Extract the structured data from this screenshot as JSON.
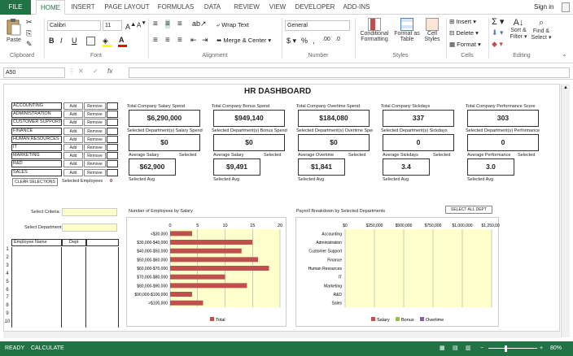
{
  "tabs": [
    "FILE",
    "HOME",
    "INSERT",
    "PAGE LAYOUT",
    "FORMULAS",
    "DATA",
    "REVIEW",
    "VIEW",
    "DEVELOPER",
    "ADD-INS"
  ],
  "account": "Sign in",
  "ribbon": {
    "clipboard": {
      "paste": "Paste",
      "label": "Clipboard"
    },
    "font": {
      "name": "Calibri",
      "size": "11",
      "label": "Font"
    },
    "alignment": {
      "wrap": "Wrap Text",
      "merge": "Merge & Center",
      "label": "Alignment"
    },
    "number": {
      "format": "General",
      "label": "Number"
    },
    "styles": {
      "cond1": "Conditional",
      "cond2": "Formatting",
      "fmt1": "Format as",
      "fmt2": "Table",
      "cell1": "Cell",
      "cell2": "Styles",
      "label": "Styles"
    },
    "cells": {
      "insert": "Insert",
      "delete": "Delete",
      "format": "Format",
      "label": "Cells"
    },
    "editing": {
      "sort1": "Sort &",
      "sort2": "Filter",
      "find1": "Find &",
      "find2": "Select",
      "label": "Editing"
    }
  },
  "formula_bar": {
    "name_box": "A50",
    "formula": ""
  },
  "dashboard": {
    "title": "HR DASHBOARD",
    "departments": [
      "ACCOUNTING",
      "ADMINISTRATION",
      "CUSTOMER SUPPORT",
      "FINANCE",
      "HUMAN RESOURCES",
      "IT",
      "MARKETING",
      "R&D",
      "SALES"
    ],
    "add_label": "Add",
    "remove_label": "Remove",
    "clear_selections": "CLEAR SELECTIONS",
    "selected_employees_label": "Selected Employees",
    "selected_employees_value": "0",
    "kpis": [
      {
        "title": "Total Company Salary Spend",
        "value": "$6,290,000",
        "sel_title": "Selected Department(s) Salary Spend",
        "sel_value": "$0",
        "avg_title": "Average Salary",
        "avg_value": "$62,900"
      },
      {
        "title": "Total Company Bonus Spend",
        "value": "$949,140",
        "sel_title": "Selected Department(s) Bonus Spend",
        "sel_value": "$0",
        "avg_title": "Average Salary",
        "avg_value": "$9,491"
      },
      {
        "title": "Total Company Overtime Spend",
        "value": "$184,080",
        "sel_title": "Selected Department(s) Overtime Spend",
        "sel_value": "$0",
        "avg_title": "Average Overtime",
        "avg_value": "$1,841"
      },
      {
        "title": "Total Company Sickdays",
        "value": "337",
        "sel_title": "Selected Department(s) Sickdays",
        "sel_value": "0",
        "avg_title": "Average Sickdays",
        "avg_value": "3.4"
      },
      {
        "title": "Total Company Performance Score",
        "value": "303",
        "sel_title": "Selected Department(s) Performance",
        "sel_value": "0",
        "avg_title": "Average Performance",
        "avg_value": "3.0"
      }
    ],
    "selected_label": "Selected",
    "selected_avg_label": "Selected Avg",
    "select_criteria_label": "Select Criteria:",
    "select_department_label": "Select Department:",
    "employee_table": {
      "headers": [
        "Employee Name",
        "Dept"
      ],
      "rows": [
        "1",
        "2",
        "3",
        "4",
        "5",
        "6",
        "7",
        "8",
        "9",
        "10"
      ]
    },
    "select_all_dept": "SELECT ALL DEPT"
  },
  "chart_data": [
    {
      "type": "bar",
      "title": "Number of Employees by Salary",
      "categories": [
        "<$30,000",
        "$30,000-$40,000",
        "$40,000-$50,000",
        "$50,000-$60,000",
        "$60,000-$70,000",
        "$70,000-$80,000",
        "$80,000-$90,000",
        "$90,000-$100,000",
        ">$100,000"
      ],
      "series": [
        {
          "name": "Total",
          "values": [
            4,
            15,
            13,
            16,
            18,
            10,
            14,
            4,
            6
          ],
          "color": "#c0504d"
        }
      ],
      "xlim": [
        0,
        20
      ],
      "xticks": [
        "0",
        "5",
        "10",
        "15",
        "20"
      ],
      "background": "#ffffcc"
    },
    {
      "type": "bar",
      "title": "Payroll Breakdown by Selected Departments",
      "categories": [
        "Accounting",
        "Administration",
        "Customer Support",
        "Finance",
        "Human Resources",
        "IT",
        "Marketing",
        "R&D",
        "Sales"
      ],
      "series": [
        {
          "name": "Salary",
          "values": [
            0,
            0,
            0,
            0,
            0,
            0,
            0,
            0,
            0
          ],
          "color": "#c0504d"
        },
        {
          "name": "Bonus",
          "values": [
            0,
            0,
            0,
            0,
            0,
            0,
            0,
            0,
            0
          ],
          "color": "#9bbb59"
        },
        {
          "name": "Overtime",
          "values": [
            0,
            0,
            0,
            0,
            0,
            0,
            0,
            0,
            0
          ],
          "color": "#8064a2"
        }
      ],
      "xticks": [
        "$0",
        "$250,000",
        "$500,000",
        "$750,000",
        "$1,000,000",
        "$1,250,000"
      ],
      "xlim": [
        0,
        1250000
      ],
      "background": "#ffffcc"
    }
  ],
  "status": {
    "ready": "READY",
    "calculate": "CALCULATE",
    "zoom": "80%"
  }
}
